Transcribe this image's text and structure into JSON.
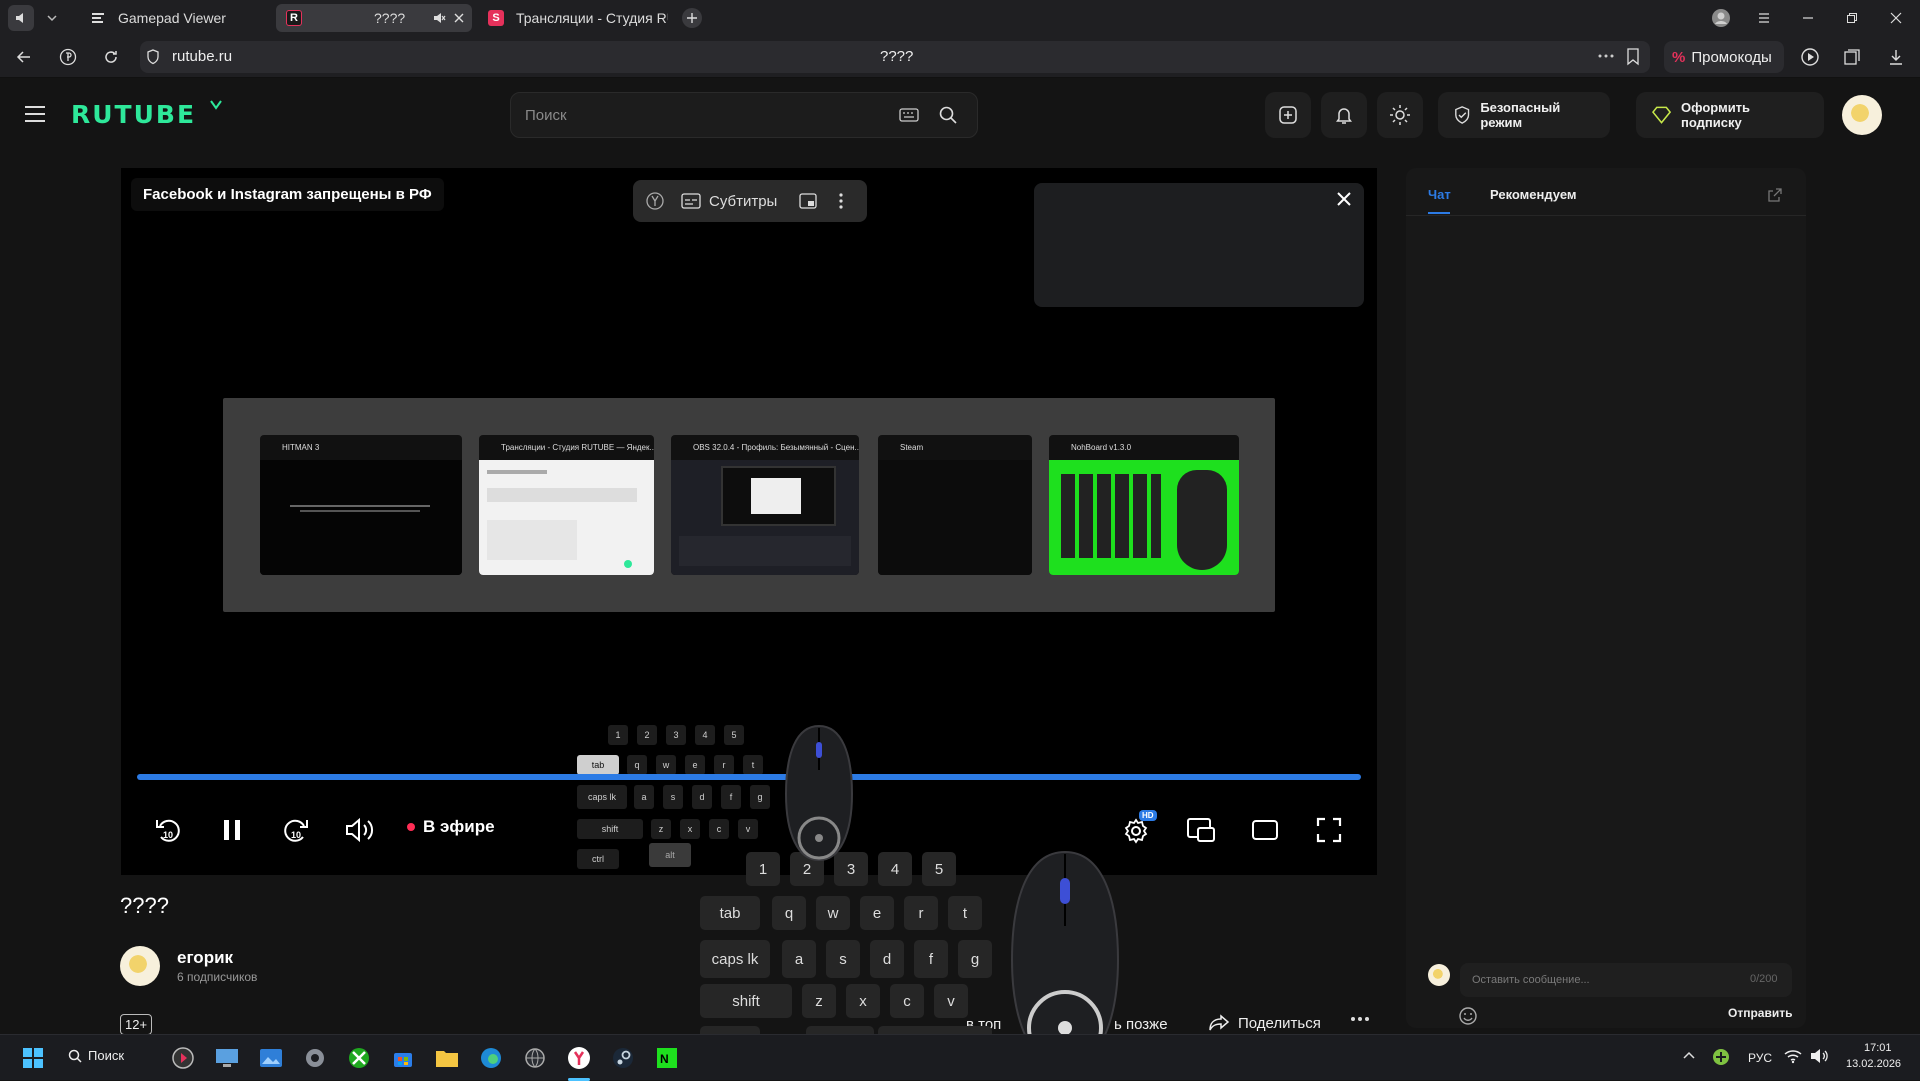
{
  "browser": {
    "tabs": [
      {
        "title": "Gamepad Viewer"
      },
      {
        "title": "????"
      },
      {
        "title": "Трансляции - Студия RUT"
      }
    ],
    "address": "rutube.ru",
    "page_title": "????",
    "promo_label": "Промокоды"
  },
  "header": {
    "logo": "RUTUBE",
    "search_placeholder": "Поиск",
    "safe_mode_label": "Безопасный режим",
    "subscribe_label": "Оформить подписку"
  },
  "player": {
    "title_overlay": "Facebook и Instagram запрещены в РФ",
    "subtitles_label": "Субтитры",
    "live_label": "В эфире",
    "quality_badge": "HD",
    "progress_fraction": 1.0,
    "switcher": [
      {
        "title": "HITMAN 3"
      },
      {
        "title": "Трансляции - Студия RUTUBE — Яндек..."
      },
      {
        "title": "OBS 32.0.4 - Профиль: Безымянный - Сцен..."
      },
      {
        "title": "Steam"
      },
      {
        "title": "NohBoard v1.3.0"
      }
    ]
  },
  "keyboard_overlay": {
    "num_keys": [
      "1",
      "2",
      "3",
      "4",
      "5"
    ],
    "row_q": [
      "tab",
      "q",
      "w",
      "e",
      "r",
      "t"
    ],
    "row_a": [
      "caps lk",
      "a",
      "s",
      "d",
      "f",
      "g"
    ],
    "row_z": [
      "shift",
      "z",
      "x",
      "c",
      "v"
    ],
    "row_ctrl": [
      "ctrl",
      "alt"
    ]
  },
  "video": {
    "title": "????",
    "channel_name": "егорик",
    "subscribers": "6 подписчиков",
    "age_rating": "12+",
    "actions": {
      "top_partial": "в топ",
      "later_partial": "ь позже",
      "share": "Поделиться"
    }
  },
  "chat": {
    "tabs": [
      "Чат",
      "Рекомендуем"
    ],
    "input_placeholder": "Оставить сообщение...",
    "char_count": "0/200",
    "send_label": "Отправить"
  },
  "taskbar": {
    "search_label": "Поиск",
    "lang": "РУС",
    "time": "17:01",
    "date": "13.02.2026"
  },
  "colors": {
    "accent_blue": "#2c7be5",
    "rutube_green": "#2ee89a",
    "live_red": "#ff2d55"
  }
}
